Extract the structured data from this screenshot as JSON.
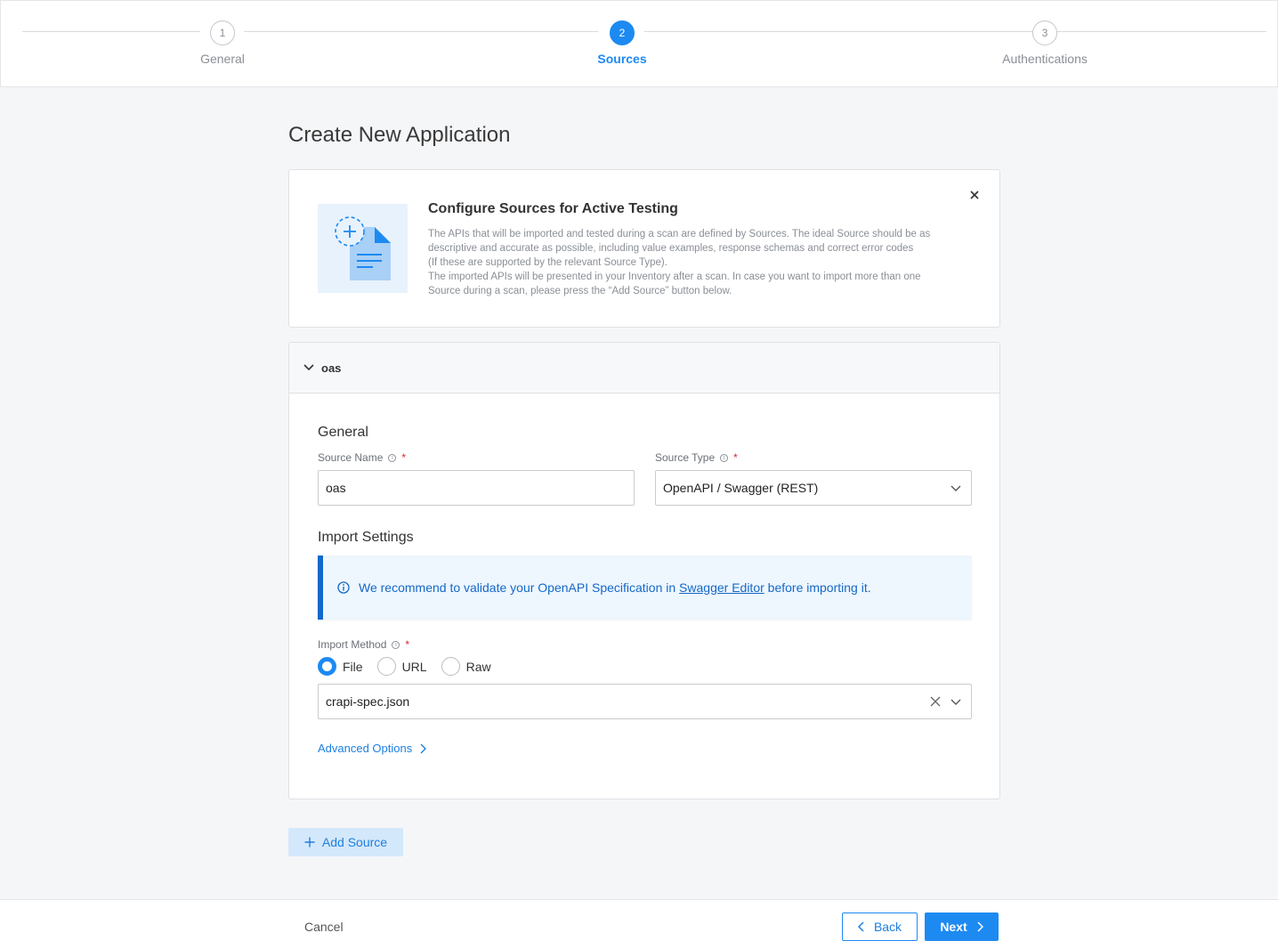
{
  "stepper": {
    "steps": [
      {
        "number": "1",
        "label": "General",
        "active": false
      },
      {
        "number": "2",
        "label": "Sources",
        "active": true
      },
      {
        "number": "3",
        "label": "Authentications",
        "active": false
      }
    ]
  },
  "page_title": "Create New Application",
  "info_card": {
    "title": "Configure Sources for Active Testing",
    "lines": [
      "The APIs that will be imported and tested during a scan are defined by Sources. The ideal Source should be as",
      "descriptive and accurate as possible, including value examples, response schemas and correct error codes",
      "(If these are supported by the relevant Source Type).",
      "The imported APIs will be presented in your Inventory after a scan. In case you want to import more than one",
      "Source during a scan, please press the “Add Source” button below."
    ]
  },
  "source": {
    "header_name": "oas",
    "general_title": "General",
    "source_name_label": "Source Name",
    "source_name_value": "oas",
    "source_type_label": "Source Type",
    "source_type_value": "OpenAPI / Swagger (REST)",
    "import_title": "Import Settings",
    "alert": {
      "before": "We recommend to validate your OpenAPI Specification in ",
      "link": "Swagger Editor",
      "after": " before importing it."
    },
    "import_method_label": "Import Method",
    "methods": [
      {
        "label": "File",
        "checked": true
      },
      {
        "label": "URL",
        "checked": false
      },
      {
        "label": "Raw",
        "checked": false
      }
    ],
    "file_value": "crapi-spec.json",
    "advanced_label": "Advanced Options"
  },
  "add_source_label": "Add Source",
  "footer": {
    "cancel": "Cancel",
    "back": "Back",
    "next": "Next"
  },
  "colors": {
    "primary": "#1d8af2",
    "required": "#e0202f",
    "alert_border": "#1169c9"
  }
}
